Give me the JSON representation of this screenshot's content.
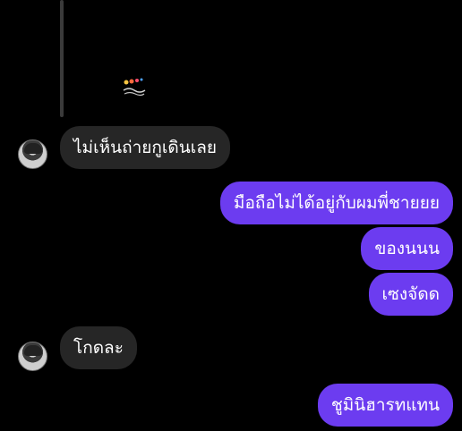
{
  "chat": {
    "sticker_icon": "emoji-sticker",
    "messages": [
      {
        "id": "m1",
        "side": "incoming",
        "text": "ไม่เห็นถ่ายกูเดินเลย"
      },
      {
        "id": "m2",
        "side": "outgoing",
        "text": "มือถือไม่ได้อยู่กับผมพี่ชายยย"
      },
      {
        "id": "m3",
        "side": "outgoing",
        "text": "ของนนน"
      },
      {
        "id": "m4",
        "side": "outgoing",
        "text": "เซงจัดด"
      },
      {
        "id": "m5",
        "side": "incoming",
        "text": "โกดละ"
      },
      {
        "id": "m6",
        "side": "outgoing",
        "text": "ชูมินิฮารทแทน"
      }
    ]
  },
  "colors": {
    "outgoing": "#6c3cf0",
    "incoming": "#262626",
    "background": "#000000"
  }
}
